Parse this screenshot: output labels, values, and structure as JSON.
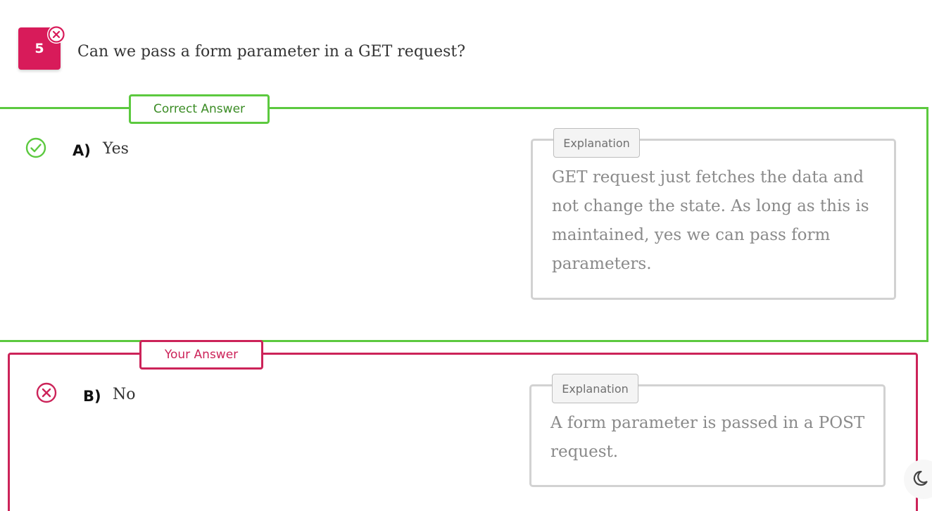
{
  "question": {
    "number": "5",
    "text": "Can we pass a form parameter in a GET request?",
    "status_icon": "x-circle-icon",
    "status_color": "#d81b5a"
  },
  "correct_answer": {
    "legend": "Correct Answer",
    "accent_color": "#5cc93f",
    "icon": "check-circle-icon",
    "letter": "A)",
    "text": "Yes",
    "explanation_label": "Explanation",
    "explanation_text": "GET request just fetches the data and not change the state. As long as this is maintained, yes we can pass form parameters."
  },
  "your_answer": {
    "legend": "Your Answer",
    "accent_color": "#cc2359",
    "icon": "x-circle-icon",
    "letter": "B)",
    "text": "No",
    "explanation_label": "Explanation",
    "explanation_text": "A form parameter is passed in a POST request."
  },
  "theme_toggle": {
    "icon": "moon-icon"
  }
}
